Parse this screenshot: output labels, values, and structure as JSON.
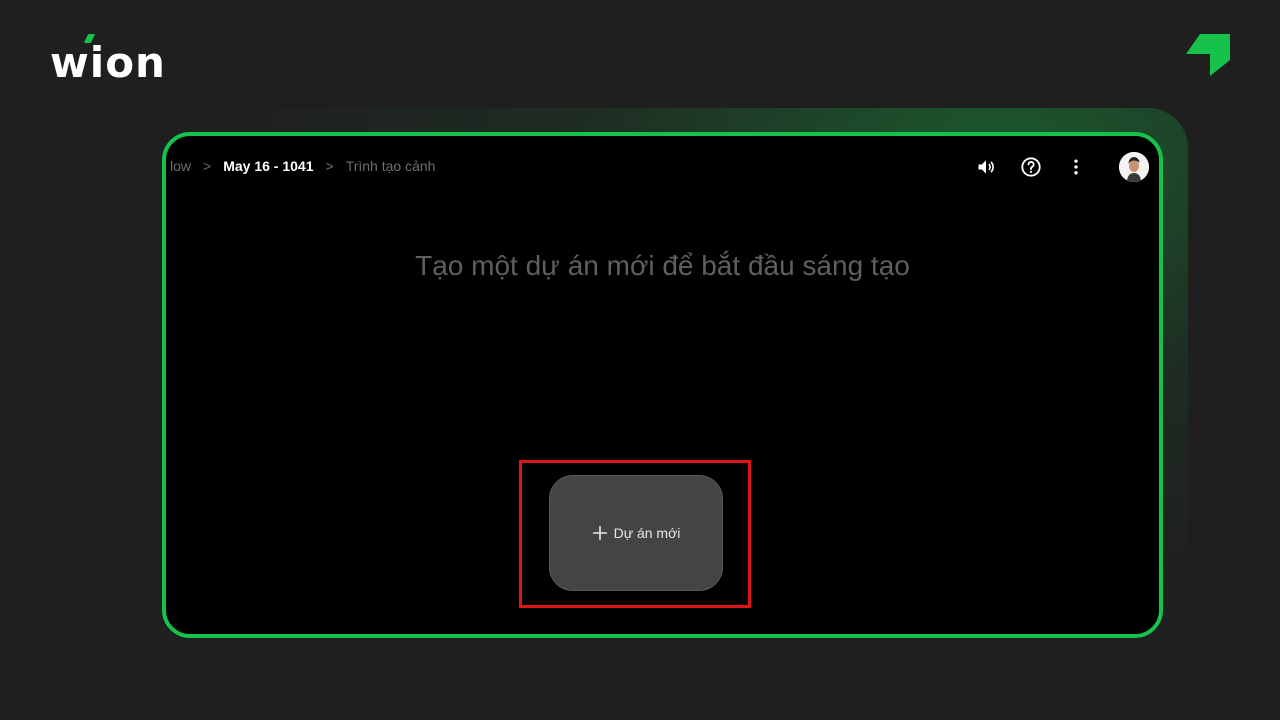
{
  "brand": {
    "logo_text": "wion",
    "accent": "#17c24a"
  },
  "breadcrumb": {
    "items": [
      "low",
      "May 16 - 1041",
      "Trình tạo cảnh"
    ],
    "separator": ">"
  },
  "toolbar": {
    "icons": [
      "volume-icon",
      "help-icon",
      "more-vert-icon",
      "avatar"
    ]
  },
  "main": {
    "headline": "Tạo một dự án mới để bắt đầu sáng tạo",
    "new_project_button": {
      "icon": "plus-icon",
      "label": "Dự án mới"
    }
  },
  "colors": {
    "background": "#1f1f1f",
    "frame_border": "#17c24a",
    "highlight": "#e01414",
    "button_bg": "#444444"
  }
}
